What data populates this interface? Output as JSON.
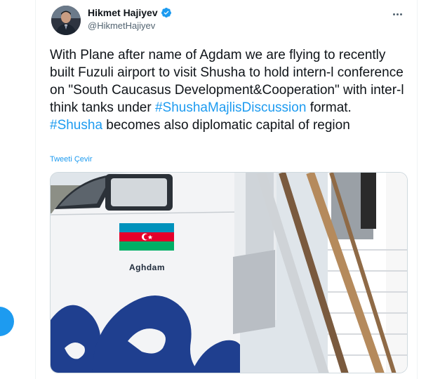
{
  "author": {
    "name": "Hikmet Hajiyev",
    "handle": "@HikmetHajiyev"
  },
  "tweet": {
    "text_parts": [
      {
        "text": "With Plane after name of Agdam we are flying to recently built Fuzuli airport to visit Shusha to hold intern-l conference on \"South Caucasus Development&Cooperation\" with inter-l think tanks under ",
        "type": "plain"
      },
      {
        "text": "#ShushaMajlisDiscussion",
        "type": "hashtag"
      },
      {
        "text": " format. ",
        "type": "plain"
      },
      {
        "text": "#Shusha",
        "type": "hashtag"
      },
      {
        "text": " becomes also diplomatic capital of region",
        "type": "plain"
      }
    ],
    "translate_label": "Tweeti Çevir"
  },
  "media": {
    "aircraft_label": "Aghdam"
  },
  "colors": {
    "accent": "#1d9bf0",
    "secondary_text": "#536471",
    "flag_blue": "#0092bc",
    "flag_red": "#e4002b",
    "flag_green": "#00af66",
    "livery_blue": "#1f3f8f"
  },
  "icons": {
    "verified": "verified-badge-icon",
    "more": "more-horizontal-icon"
  }
}
